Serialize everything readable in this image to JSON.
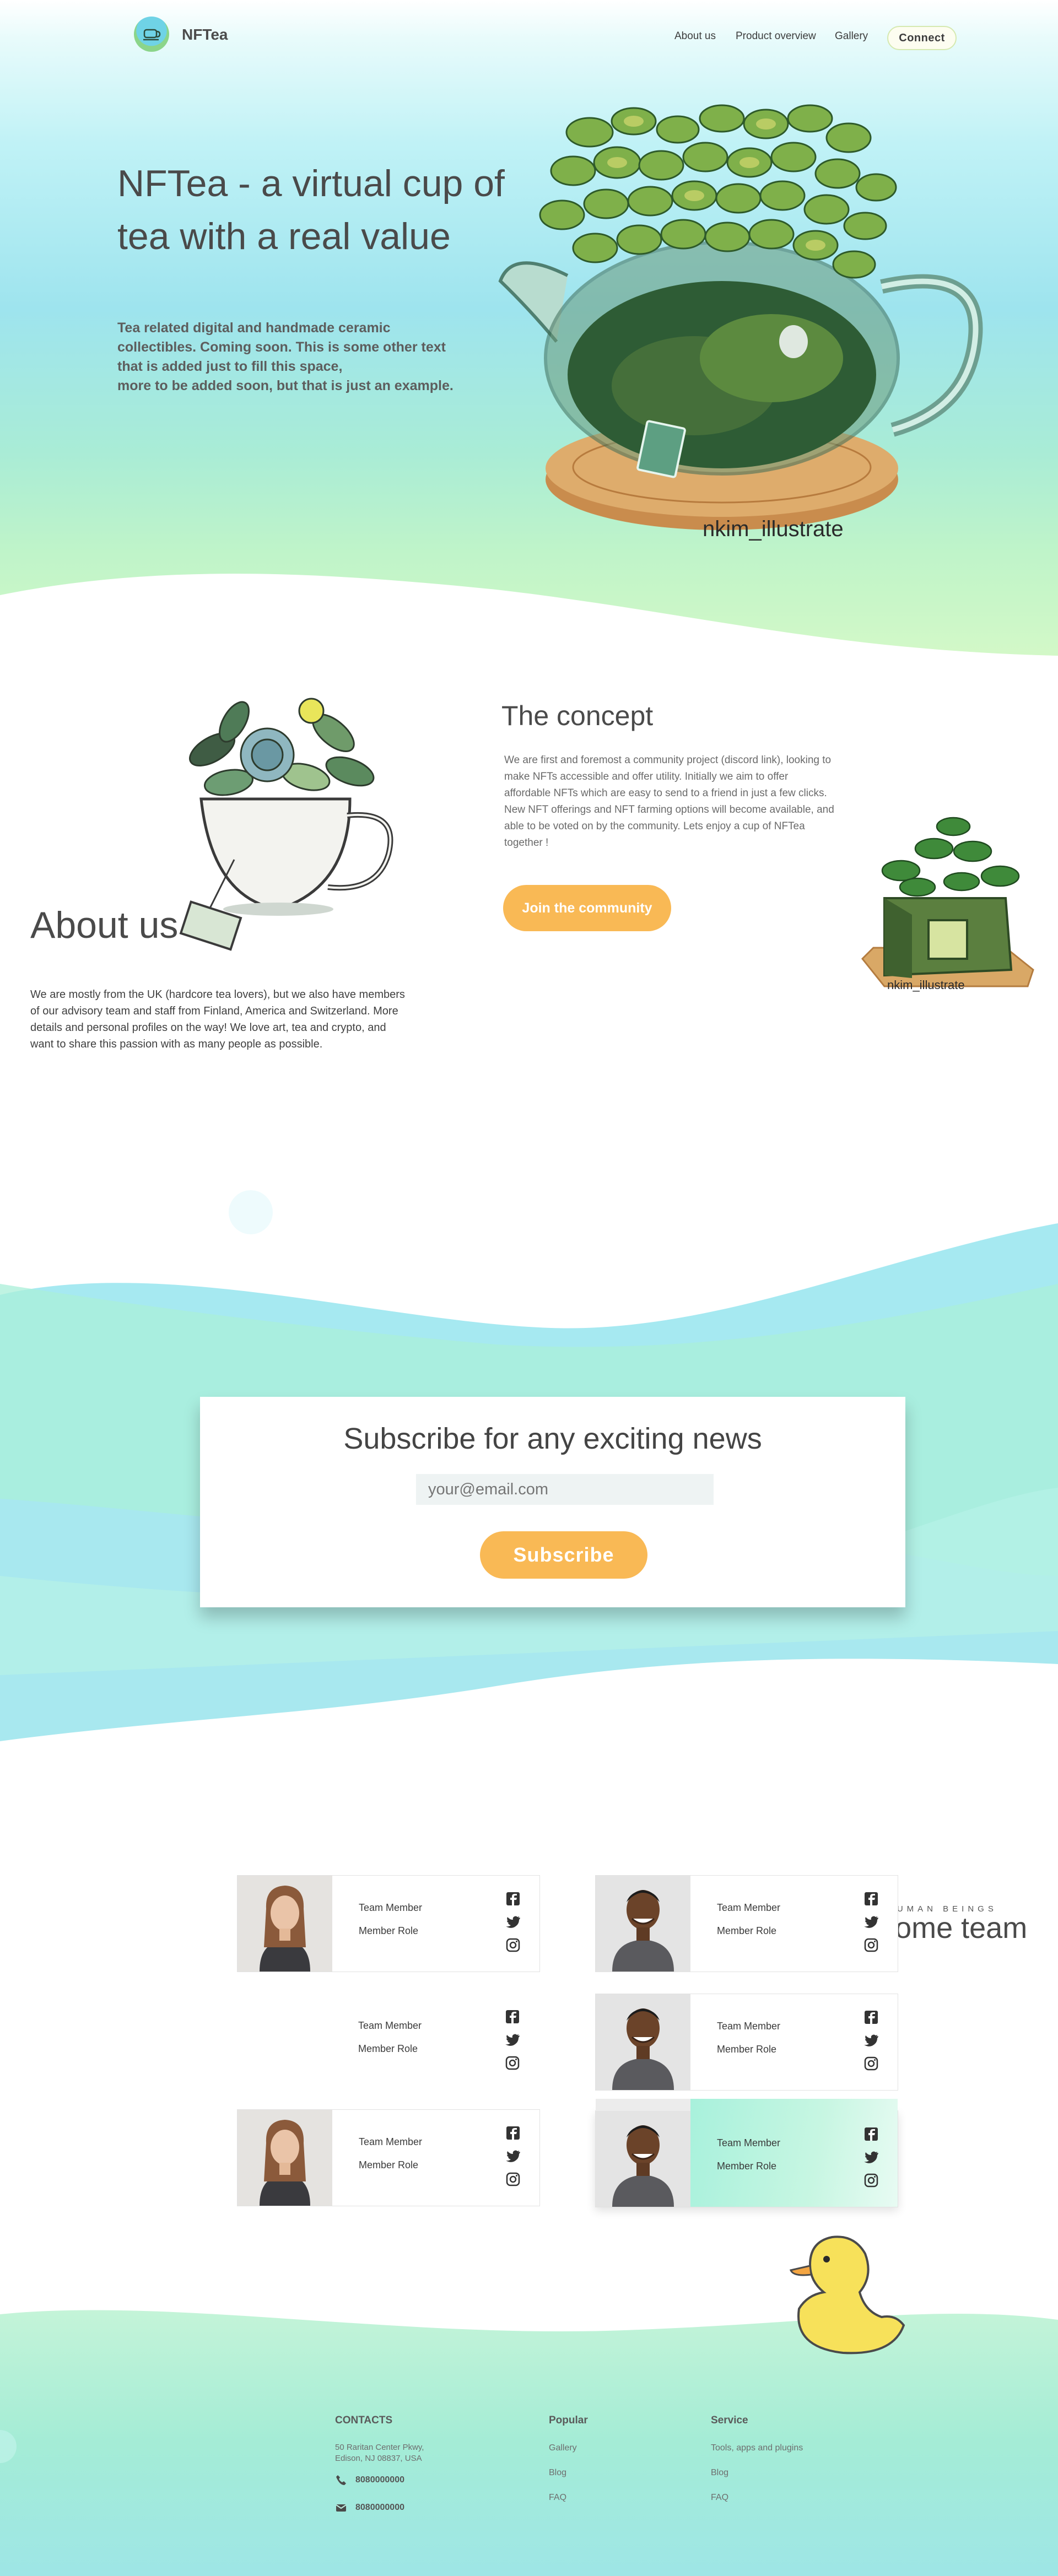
{
  "brand": {
    "name": "NFTea"
  },
  "nav": {
    "links": [
      "About us",
      "Product overview",
      "Gallery"
    ],
    "connect_label": "Connect"
  },
  "hero": {
    "title_line1": "NFTea - a virtual cup of",
    "title_line2": "tea with a real value",
    "sub_lines": [
      "Tea related digital and handmade ceramic",
      "collectibles. Coming soon. This is some other text",
      "that is added just to fill this space,",
      "more to be added soon, but that is just an example."
    ],
    "art_credit": "nkim_illustrate"
  },
  "about": {
    "title": "About us",
    "text": "We are mostly from the UK (hardcore tea lovers), but we also have members of our advisory team and staff from Finland, America and Switzerland. More details and personal profiles on the way! We love art, tea and crypto, and want to share this passion with as many people as possible."
  },
  "concept": {
    "title": "The concept",
    "text": "We are first and foremost a community project (discord link), looking to make NFTs accessible and offer utility. Initially we aim to offer affordable NFTs which are easy to send to a friend in just a few clicks. New NFT offerings and NFT farming options will become available, and able to be voted on by the community. Lets enjoy a cup of NFTea together !",
    "join_label": "Join the community",
    "art_credit": "nkim_illustrate"
  },
  "subscribe": {
    "title": "Subscribe for any exciting news",
    "placeholder": "your@email.com",
    "button_label": "Subscribe"
  },
  "team": {
    "eyebrow": "HUMAN BEINGS",
    "title": "Our awesome team",
    "members": [
      {
        "name": "Team Member",
        "role": "Member Role"
      },
      {
        "name": "Team Member",
        "role": "Member Role"
      },
      {
        "name": "Team Member",
        "role": "Member Role"
      },
      {
        "name": "Team Member",
        "role": "Member Role"
      },
      {
        "name": "Team Member",
        "role": "Member Role"
      },
      {
        "name": "Team Member",
        "role": "Member Role"
      }
    ]
  },
  "footer": {
    "contacts": {
      "title": "CONTACTS",
      "address_line1": "50 Raritan Center Pkwy,",
      "address_line2": "Edison, NJ 08837, USA",
      "phone": "8080000000",
      "email": "8080000000"
    },
    "popular": {
      "title": "Popular",
      "links": [
        "Gallery",
        "Blog",
        "FAQ"
      ]
    },
    "service": {
      "title": "Service",
      "links": [
        "Tools, apps and plugins",
        "Blog",
        "FAQ"
      ]
    }
  },
  "colors": {
    "accent": "#f9b955",
    "mint": "#a9ecd6",
    "sky": "#9ee4ee",
    "text": "#4a4a4a"
  },
  "icons": [
    "teacup-logo-icon",
    "facebook-icon",
    "twitter-icon",
    "instagram-icon",
    "phone-icon",
    "mail-icon"
  ]
}
